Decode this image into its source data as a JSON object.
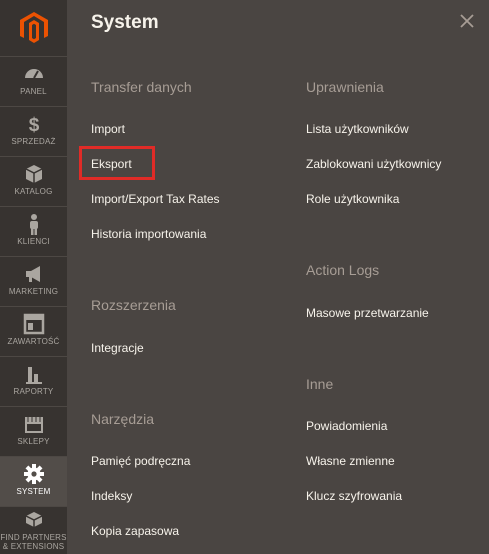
{
  "sidebar": {
    "items": [
      {
        "label": "PANEL",
        "icon": "dashboard-icon"
      },
      {
        "label": "SPRZEDAŻ",
        "icon": "dollar-icon"
      },
      {
        "label": "KATALOG",
        "icon": "box-icon"
      },
      {
        "label": "KLIENCI",
        "icon": "person-icon"
      },
      {
        "label": "MARKETING",
        "icon": "megaphone-icon"
      },
      {
        "label": "ZAWARTOŚĆ",
        "icon": "layout-icon"
      },
      {
        "label": "RAPORTY",
        "icon": "bar-chart-icon"
      },
      {
        "label": "SKLEPY",
        "icon": "store-icon"
      },
      {
        "label": "SYSTEM",
        "icon": "gear-icon"
      },
      {
        "label": "FIND PARTNERS & EXTENSIONS",
        "icon": "cubes-icon"
      }
    ]
  },
  "panel": {
    "title": "System",
    "left": {
      "transfer_title": "Transfer danych",
      "transfer_items": [
        "Import",
        "Eksport",
        "Import/Export Tax Rates",
        "Historia importowania"
      ],
      "extensions_title": "Rozszerzenia",
      "extensions_items": [
        "Integracje"
      ],
      "tools_title": "Narzędzia",
      "tools_items": [
        "Pamięć podręczna",
        "Indeksy",
        "Kopia zapasowa"
      ]
    },
    "right": {
      "perm_title": "Uprawnienia",
      "perm_items": [
        "Lista użytkowników",
        "Zablokowani użytkownicy",
        "Role użytkownika"
      ],
      "action_title": "Action Logs",
      "action_items": [
        "Masowe przetwarzanie"
      ],
      "other_title": "Inne",
      "other_items": [
        "Powiadomienia",
        "Własne zmienne",
        "Klucz szyfrowania"
      ]
    }
  },
  "colors": {
    "accent": "#eb5202",
    "highlight": "#e02b27"
  }
}
